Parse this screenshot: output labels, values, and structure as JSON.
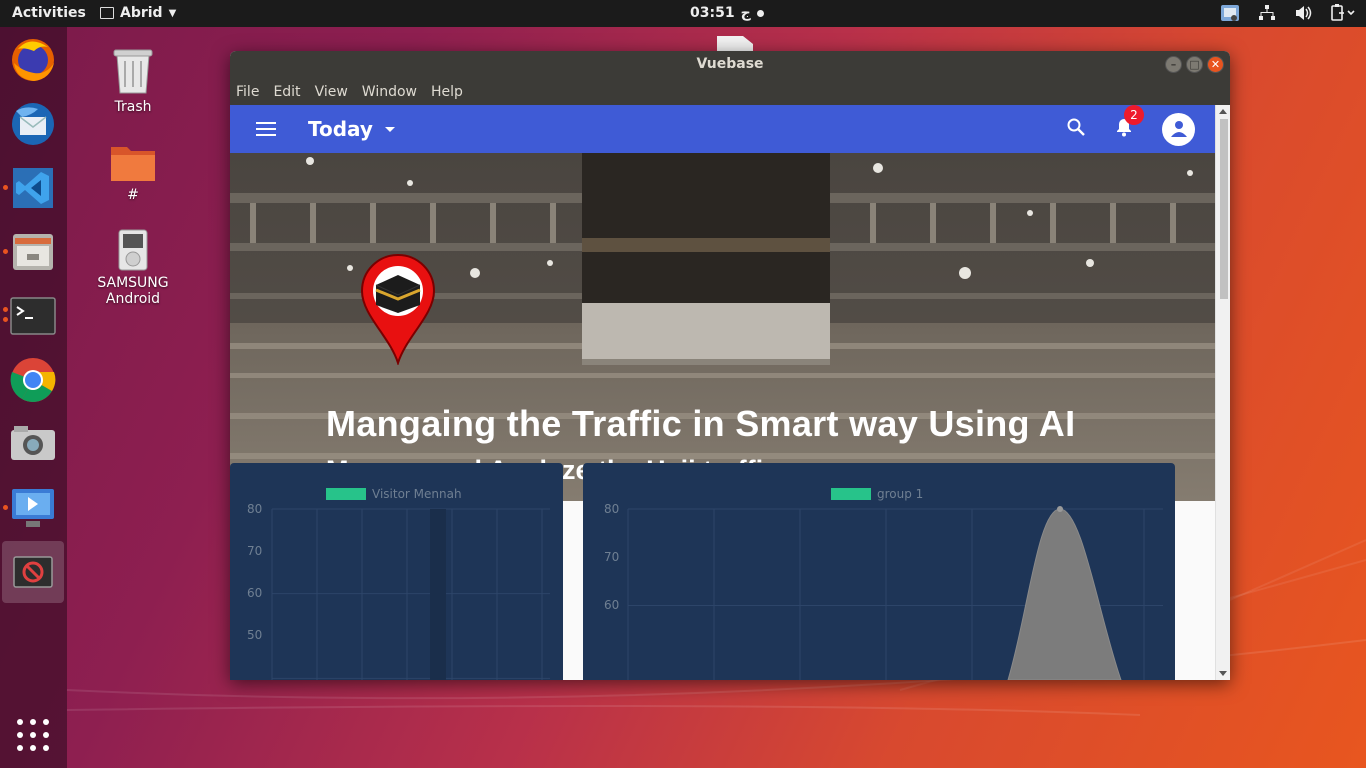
{
  "topbar": {
    "activities": "Activities",
    "app_name": "Abrid",
    "clock": "03:51",
    "clock_suffix": "ج"
  },
  "desktop": {
    "icons": [
      {
        "label": "Trash",
        "icon": "trash-icon"
      },
      {
        "label": "#",
        "icon": "folder-icon"
      },
      {
        "label": "SAMSUNG Android",
        "icon": "media-player-icon"
      }
    ]
  },
  "dock": {
    "items": [
      "firefox-icon",
      "thunderbird-icon",
      "vscode-icon",
      "file-manager-icon",
      "terminal-icon",
      "chrome-icon",
      "camera-icon",
      "video-editor-icon",
      "blocked-app-icon"
    ]
  },
  "window": {
    "title": "Vuebase",
    "menu": [
      "File",
      "Edit",
      "View",
      "Window",
      "Help"
    ]
  },
  "app": {
    "toolbar_title": "Today",
    "notification_count": "2",
    "hero_title": "Mangaing the Traffic in Smart way Using AI",
    "hero_subtitle": "Manage and Analyze the Hajj traffic",
    "accent_color": "#3f5bd6",
    "badge_color": "#ee1a2c"
  },
  "chart_data": [
    {
      "type": "bar",
      "legend": "Visitor Mennah",
      "series_color": "#27c38a",
      "yticks": [
        "80",
        "70",
        "60",
        "50"
      ],
      "ylim": [
        50,
        80
      ]
    },
    {
      "type": "area",
      "legend": "group 1",
      "series_color": "#27c38a",
      "yticks": [
        "80",
        "70",
        "60"
      ],
      "ylim": [
        60,
        80
      ],
      "peak_value": 80
    }
  ]
}
